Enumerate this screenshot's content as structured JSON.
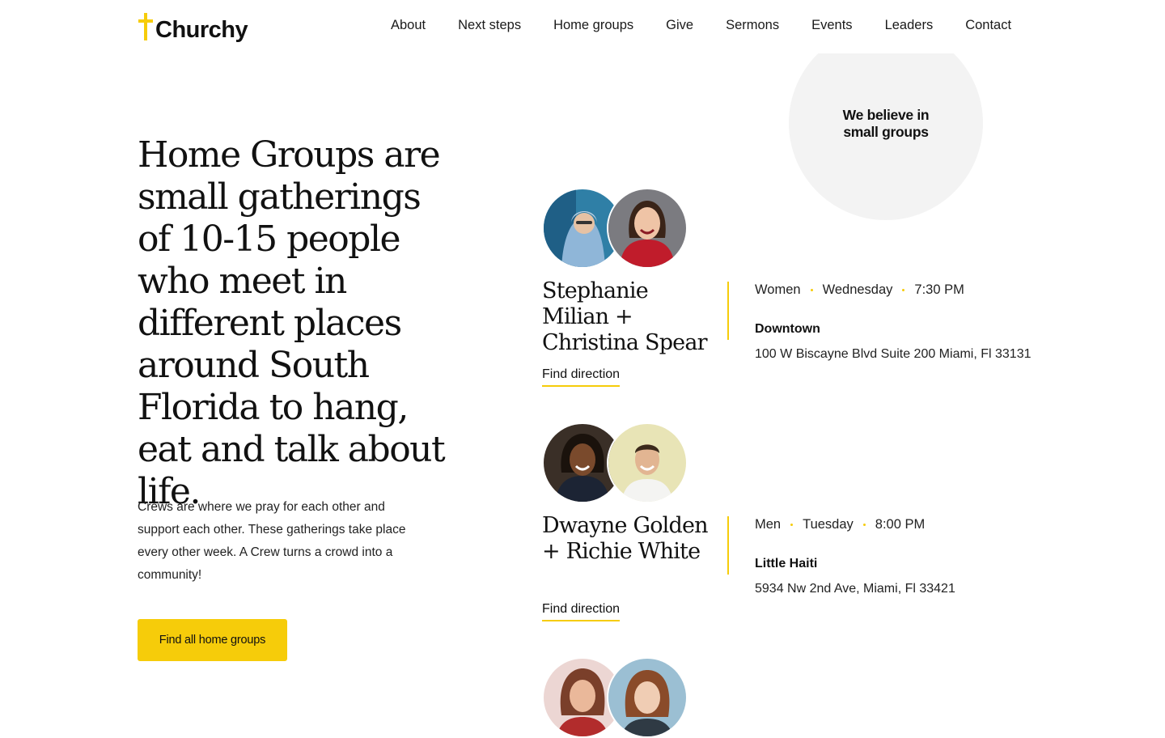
{
  "brand": {
    "name": "Churchy",
    "accent_color": "#f6cc0a"
  },
  "nav": {
    "items": [
      {
        "label": "About"
      },
      {
        "label": "Next steps"
      },
      {
        "label": "Home groups"
      },
      {
        "label": "Give"
      },
      {
        "label": "Sermons"
      },
      {
        "label": "Events"
      },
      {
        "label": "Leaders"
      },
      {
        "label": "Contact"
      }
    ]
  },
  "badge": {
    "text": "We believe in small groups"
  },
  "hero": {
    "title": "Home Groups are small gatherings of 10-15 people who meet in different places around South Florida to hang, eat and talk about life.",
    "body": "Crews are where we pray for each other and support each other. These gatherings take place every other week. A Crew turns a crowd into a community!",
    "cta_label": "Find all home groups"
  },
  "groups": [
    {
      "leaders": "Stephanie Milian + Christina Spear",
      "audience": "Women",
      "day": "Wednesday",
      "time": "7:30 PM",
      "location": "Downtown",
      "address": "100 W Biscayne Blvd Suite 200 Miami, Fl 33131",
      "link_label": "Find direction"
    },
    {
      "leaders": "Dwayne Golden + Richie White",
      "audience": "Men",
      "day": "Tuesday",
      "time": "8:00 PM",
      "location": "Little Haiti",
      "address": "5934 Nw 2nd Ave, Miami, Fl 33421",
      "link_label": "Find direction"
    }
  ]
}
